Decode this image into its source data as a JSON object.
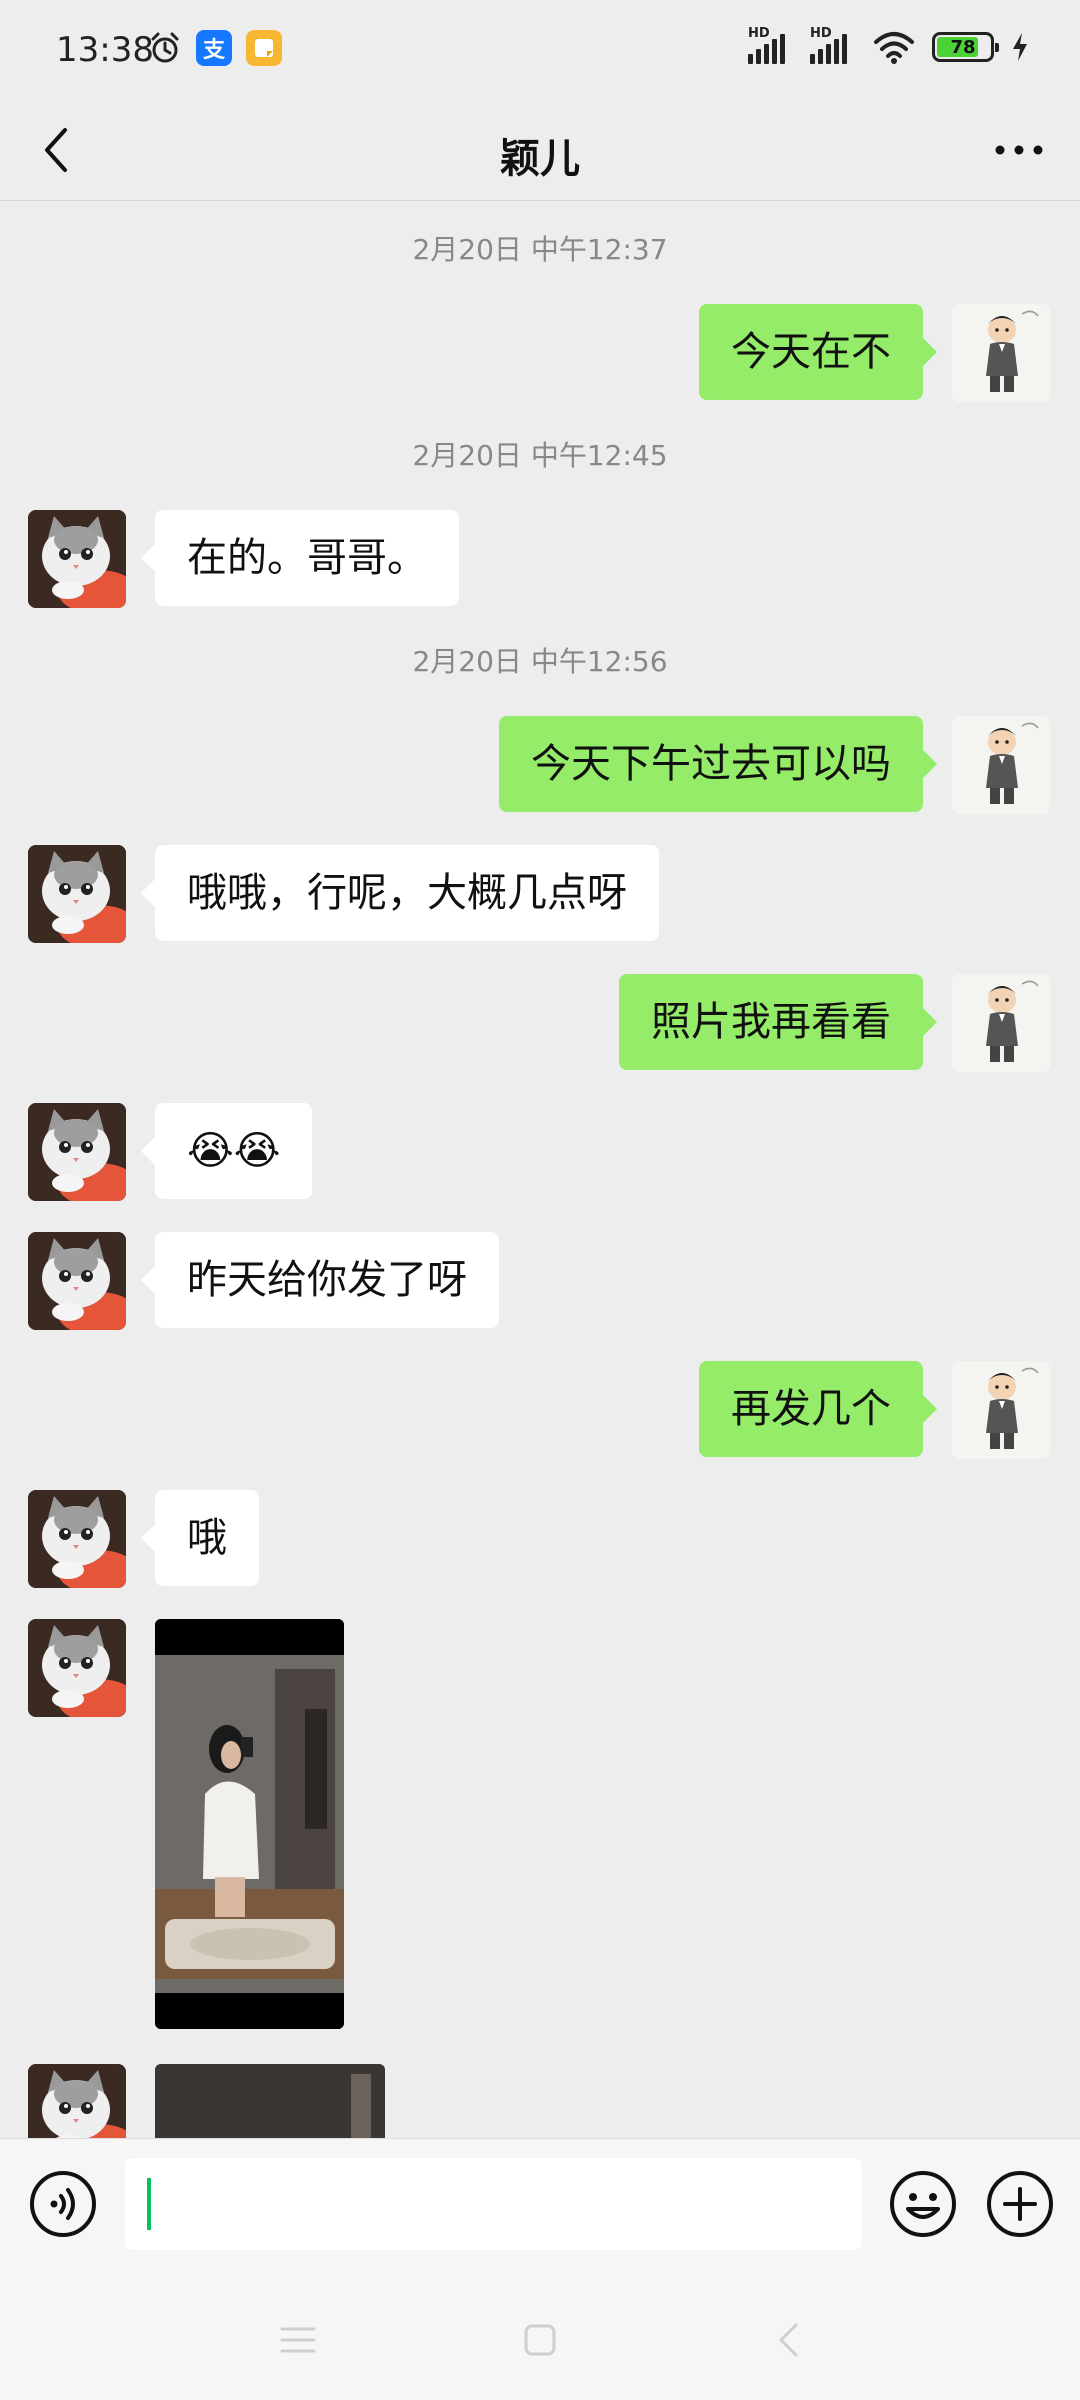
{
  "status_bar": {
    "time": "13:38",
    "hd_label": "HD",
    "battery": "78",
    "battery_level": 0.78,
    "app_icon_1": "支",
    "icons": [
      "alarm-icon",
      "alipay-app-icon",
      "notes-app-icon",
      "signal-icon",
      "wifi-icon",
      "battery-icon",
      "charging-icon"
    ]
  },
  "nav": {
    "title": "颖儿",
    "back_icon": "chevron-left-icon",
    "more_icon": "more-dots-icon"
  },
  "messages": [
    {
      "type": "timestamp",
      "text": "2月20日 中午12:37"
    },
    {
      "type": "bubble",
      "side": "right",
      "text": "今天在不"
    },
    {
      "type": "timestamp",
      "text": "2月20日 中午12:45"
    },
    {
      "type": "bubble",
      "side": "left",
      "text": "在的。哥哥。"
    },
    {
      "type": "timestamp",
      "text": "2月20日 中午12:56"
    },
    {
      "type": "bubble",
      "side": "right",
      "text": "今天下午过去可以吗"
    },
    {
      "type": "bubble",
      "side": "left",
      "text": "哦哦，行呢，大概几点呀"
    },
    {
      "type": "bubble",
      "side": "right",
      "text": "照片我再看看"
    },
    {
      "type": "bubble",
      "side": "left",
      "text": "😭😭"
    },
    {
      "type": "bubble",
      "side": "left",
      "text": "昨天给你发了呀"
    },
    {
      "type": "bubble",
      "side": "right",
      "text": "再发几个"
    },
    {
      "type": "bubble",
      "side": "left",
      "text": "哦"
    },
    {
      "type": "image",
      "side": "left"
    },
    {
      "type": "image",
      "side": "left",
      "partial": true
    }
  ],
  "input_bar": {
    "text": "",
    "icons": [
      "voice-icon",
      "emoji-icon",
      "plus-icon"
    ]
  },
  "system_nav": {
    "icons": [
      "menu-icon",
      "home-icon",
      "back-icon"
    ]
  },
  "colors": {
    "background": "#ededed",
    "bubble_mine": "#95ec69",
    "bubble_theirs": "#ffffff",
    "timestamp_text": "#888888",
    "cursor": "#07c160"
  }
}
